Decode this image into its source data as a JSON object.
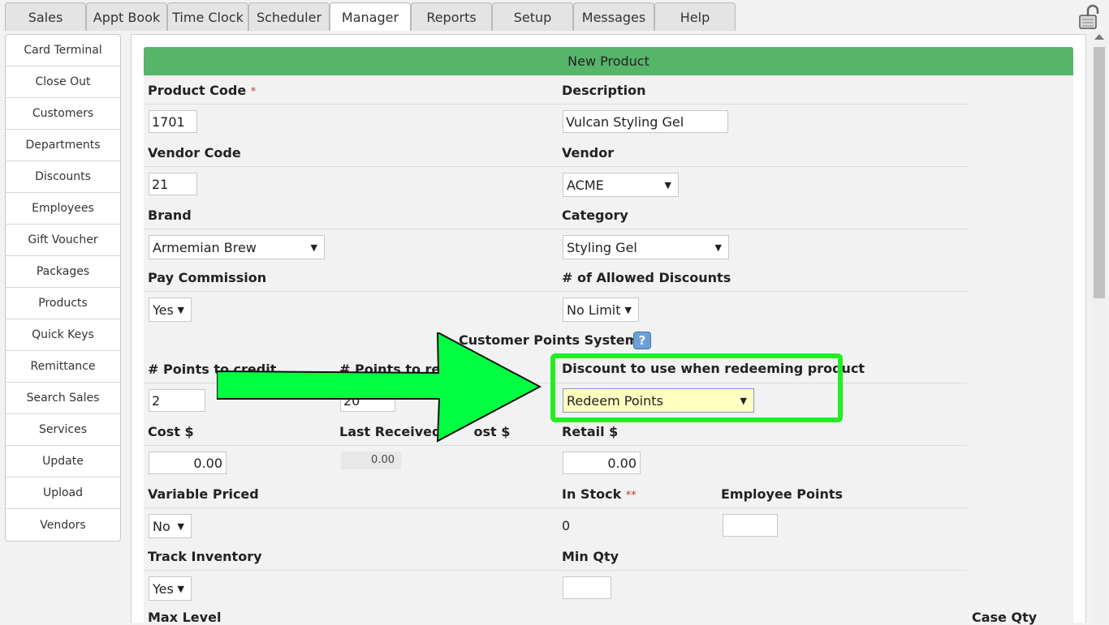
{
  "tabs": [
    "Sales",
    "Appt Book",
    "Time Clock",
    "Scheduler",
    "Manager",
    "Reports",
    "Setup",
    "Messages",
    "Help"
  ],
  "active_tab": "Manager",
  "sidebar": [
    "Card Terminal",
    "Close Out",
    "Customers",
    "Departments",
    "Discounts",
    "Employees",
    "Gift Voucher",
    "Packages",
    "Products",
    "Quick Keys",
    "Remittance",
    "Search Sales",
    "Services",
    "Update",
    "Upload",
    "Vendors"
  ],
  "form": {
    "title": "New Product",
    "product_code_label": "Product Code",
    "product_code_value": "1701",
    "description_label": "Description",
    "description_value": "Vulcan Styling Gel",
    "vendor_code_label": "Vendor Code",
    "vendor_code_value": "21",
    "vendor_label": "Vendor",
    "vendor_value": "ACME",
    "brand_label": "Brand",
    "brand_value": "Armemian Brew",
    "category_label": "Category",
    "category_value": "Styling Gel",
    "pay_commission_label": "Pay Commission",
    "pay_commission_value": "Yes",
    "allowed_discounts_label": "# of Allowed Discounts",
    "allowed_discounts_value": "No Limit",
    "points_system_label": "Customer Points System",
    "points_credit_label": "# Points to credit",
    "points_credit_value": "2",
    "points_redeem_label": "# Points to rede",
    "points_redeem_value": "20",
    "redeem_discount_label": "Discount to use when redeeming product",
    "redeem_discount_value": "Redeem Points",
    "cost_label": "Cost $",
    "cost_value": "0.00",
    "last_received_label": "Last Received",
    "last_received_label_tail": "ost $",
    "last_received_value": "0.00",
    "retail_label": "Retail $",
    "retail_value": "0.00",
    "variable_priced_label": "Variable Priced",
    "variable_priced_value": "No",
    "in_stock_label": "In Stock",
    "in_stock_value": "0",
    "employee_points_label": "Employee Points",
    "track_inventory_label": "Track Inventory",
    "track_inventory_value": "Yes",
    "min_qty_label": "Min Qty",
    "max_level_label": "Max Level",
    "case_qty_label": "Case Qty",
    "required_mark": "*",
    "double_mark": "**",
    "help_mark": "?"
  },
  "colors": {
    "header_green": "#57b56a",
    "highlight": "#22ee22",
    "arrow": "#00ff40",
    "redeem_bg": "#ffffc0"
  }
}
